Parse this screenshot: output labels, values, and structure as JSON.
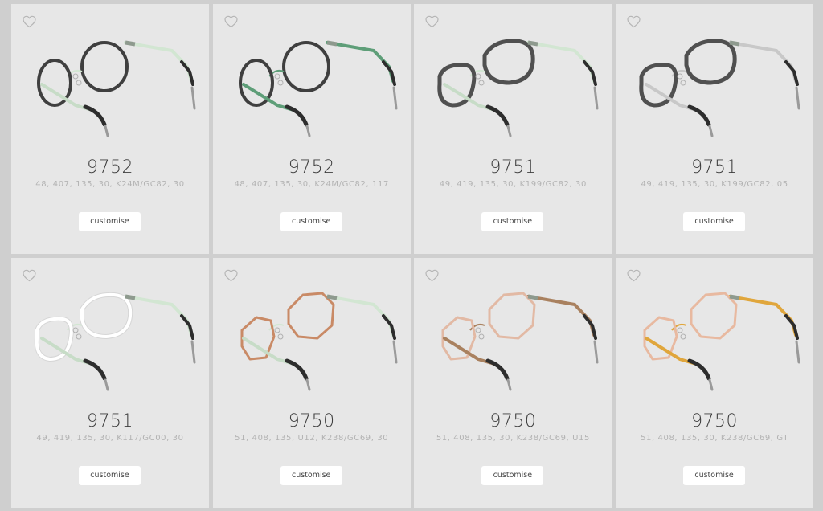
{
  "products": [
    {
      "model": "9752",
      "spec": "48, 407, 135, 30, K24M/GC82, 30",
      "button": "customise",
      "frame_color": "#3f3f3f",
      "temple_color": "#d2e6d2",
      "lens_fill": "none"
    },
    {
      "model": "9752",
      "spec": "48, 407, 135, 30, K24M/GC82, 117",
      "button": "customise",
      "frame_color": "#3f3f3f",
      "temple_color": "#5e9e78",
      "lens_fill": "none"
    },
    {
      "model": "9751",
      "spec": "49, 419, 135, 30, K199/GC82, 30",
      "button": "customise",
      "frame_color": "#505050",
      "temple_color": "#d2e6d2",
      "lens_fill": "none"
    },
    {
      "model": "9751",
      "spec": "49, 419, 135, 30, K199/GC82, 05",
      "button": "customise",
      "frame_color": "#505050",
      "temple_color": "#c8c8c8",
      "lens_fill": "none"
    },
    {
      "model": "9751",
      "spec": "49, 419, 135, 30, K117/GC00, 30",
      "button": "customise",
      "frame_color": "#ffffff",
      "temple_color": "#d2e6d2",
      "lens_fill": "none"
    },
    {
      "model": "9750",
      "spec": "51, 408, 135, U12, K238/GC69, 30",
      "button": "customise",
      "frame_color": "#c98a66",
      "temple_color": "#d2e6d2",
      "lens_fill": "none"
    },
    {
      "model": "9750",
      "spec": "51, 408, 135, 30, K238/GC69, U15",
      "button": "customise",
      "frame_color": "#e2b9a4",
      "temple_color": "#a9815f",
      "lens_fill": "none"
    },
    {
      "model": "9750",
      "spec": "51, 408, 135, 30, K238/GC69, GT",
      "button": "customise",
      "frame_color": "#e8b9a0",
      "temple_color": "#e0a63c",
      "lens_fill": "none"
    }
  ],
  "icons": {
    "favorite": "heart-outline-icon"
  },
  "colors": {
    "page_bg": "#cfcfcf",
    "card_bg": "#e7e7e7",
    "tip_color": "#2d2d2d"
  }
}
